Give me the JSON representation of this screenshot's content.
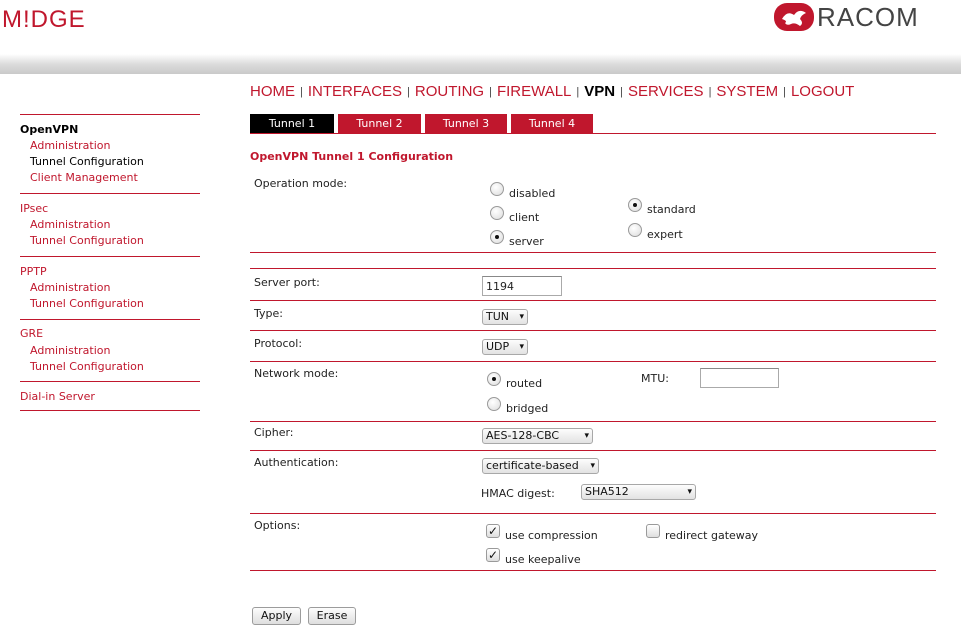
{
  "header": {
    "brand_left": "M!DGE",
    "brand_right": "RACOM"
  },
  "nav": {
    "items": [
      "HOME",
      "INTERFACES",
      "ROUTING",
      "FIREWALL",
      "VPN",
      "SERVICES",
      "SYSTEM",
      "LOGOUT"
    ],
    "active": "VPN"
  },
  "tabs": [
    "Tunnel 1",
    "Tunnel 2",
    "Tunnel 3",
    "Tunnel 4"
  ],
  "sidebar": {
    "openvpn": {
      "title": "OpenVPN",
      "items": [
        "Administration",
        "Tunnel Configuration",
        "Client Management"
      ]
    },
    "ipsec": {
      "title": "IPsec",
      "items": [
        "Administration",
        "Tunnel Configuration"
      ]
    },
    "pptp": {
      "title": "PPTP",
      "items": [
        "Administration",
        "Tunnel Configuration"
      ]
    },
    "gre": {
      "title": "GRE",
      "items": [
        "Administration",
        "Tunnel Configuration"
      ]
    },
    "dialin": {
      "title": "Dial-in Server"
    }
  },
  "form": {
    "title": "OpenVPN Tunnel 1 Configuration",
    "operation_mode": {
      "label": "Operation mode:",
      "options": [
        "disabled",
        "client",
        "server"
      ],
      "selected": "server",
      "sub_options": [
        "standard",
        "expert"
      ],
      "sub_selected": "standard"
    },
    "server_port": {
      "label": "Server port:",
      "value": "1194"
    },
    "type": {
      "label": "Type:",
      "value": "TUN"
    },
    "protocol": {
      "label": "Protocol:",
      "value": "UDP"
    },
    "network_mode": {
      "label": "Network mode:",
      "options": [
        "routed",
        "bridged"
      ],
      "selected": "routed",
      "mtu_label": "MTU:",
      "mtu_value": ""
    },
    "cipher": {
      "label": "Cipher:",
      "value": "AES-128-CBC"
    },
    "authentication": {
      "label": "Authentication:",
      "value": "certificate-based",
      "hmac_label": "HMAC digest:",
      "hmac_value": "SHA512"
    },
    "options": {
      "label": "Options:",
      "use_compression": "use compression",
      "use_keepalive": "use keepalive",
      "redirect_gateway": "redirect gateway",
      "use_compression_checked": true,
      "use_keepalive_checked": true,
      "redirect_gateway_checked": false
    }
  },
  "buttons": {
    "apply": "Apply",
    "erase": "Erase"
  },
  "colors": {
    "accent": "#c0172d",
    "active_tab": "#000000"
  }
}
